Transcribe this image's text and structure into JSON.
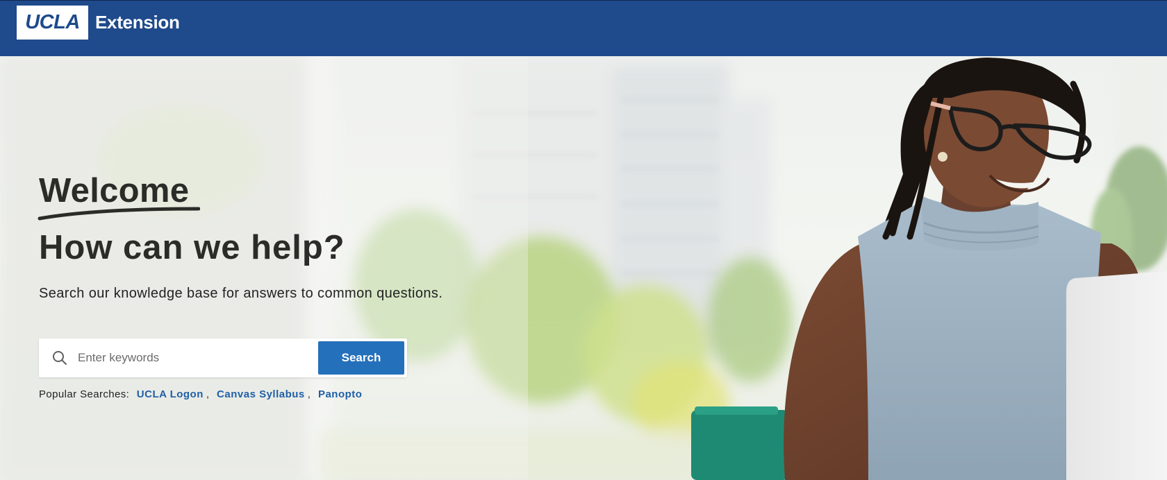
{
  "header": {
    "logo_ucla": "UCLA",
    "logo_extension": "Extension",
    "bar_color": "#1f4a8c"
  },
  "hero": {
    "welcome": "Welcome",
    "heading": "How can we help?",
    "subtitle": "Search our knowledge base for answers to common questions.",
    "search": {
      "placeholder": "Enter keywords",
      "value": "",
      "button_label": "Search",
      "icon": "search-icon",
      "button_color": "#2470bb"
    },
    "popular": {
      "label": "Popular Searches:",
      "links": [
        "UCLA Logon",
        "Canvas Syllabus",
        "Panopto"
      ],
      "separator": ",",
      "link_color": "#1f5fa8"
    }
  }
}
